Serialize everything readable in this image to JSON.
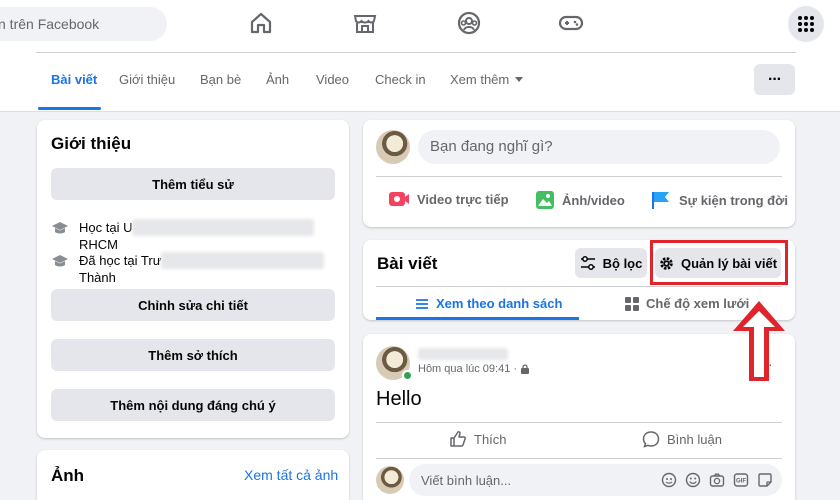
{
  "topbar": {
    "search_placeholder": "n trên Facebook",
    "nav_icons": [
      "home-icon",
      "marketplace-icon",
      "groups-icon",
      "gaming-icon"
    ],
    "menu_icon": "grid-menu-icon"
  },
  "profile_tabs": {
    "items": [
      "Bài viết",
      "Giới thiệu",
      "Bạn bè",
      "Ảnh",
      "Video",
      "Check in",
      "Xem thêm"
    ],
    "active": "Bài viết",
    "more_label": "···"
  },
  "intro": {
    "title": "Giới thiệu",
    "add_bio": "Thêm tiểu sử",
    "study_prefix": "Học tại U",
    "study_suffix": "RHCM",
    "studied_prefix": "Đã học tại Trư",
    "studied_suffix": "Thành",
    "edit_details": "Chỉnh sửa chi tiết",
    "add_hobbies": "Thêm sở thích",
    "add_featured": "Thêm nội dung đáng chú ý"
  },
  "photos": {
    "title": "Ảnh",
    "see_all": "Xem tất cả ảnh"
  },
  "composer": {
    "placeholder": "Bạn đang nghĩ gì?",
    "live_video": "Video trực tiếp",
    "photo_video": "Ảnh/video",
    "life_event": "Sự kiện trong đời"
  },
  "posts_header": {
    "title": "Bài viết",
    "filter": "Bộ lọc",
    "manage": "Quản lý bài viết",
    "list_view": "Xem theo danh sách",
    "grid_view": "Chế độ xem lưới"
  },
  "post": {
    "time": "Hôm qua lúc 09:41 ·",
    "text": "Hello",
    "like": "Thích",
    "comment": "Bình luận",
    "comment_placeholder": "Viết bình luận..."
  },
  "colors": {
    "accent": "#1b74e4",
    "highlight": "#e0242b"
  }
}
